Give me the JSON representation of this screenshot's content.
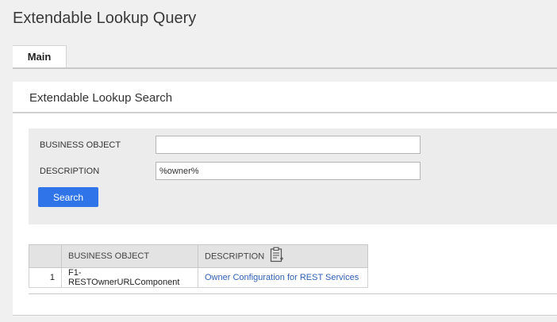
{
  "page": {
    "title": "Extendable Lookup Query"
  },
  "tabs": [
    {
      "label": "Main"
    }
  ],
  "panel": {
    "title": "Extendable Lookup Search"
  },
  "search": {
    "business_object_label": "BUSINESS OBJECT",
    "business_object_value": "",
    "description_label": "DESCRIPTION",
    "description_value": "%owner%",
    "button_label": "Search"
  },
  "results": {
    "columns": [
      "BUSINESS OBJECT",
      "DESCRIPTION"
    ],
    "rows": [
      {
        "index": "1",
        "business_object": "F1-RESTOwnerURLComponent",
        "description": "Owner Configuration for REST Services"
      }
    ]
  },
  "icons": {
    "description_header_icon": "clipboard-icon"
  },
  "colors": {
    "button": "#2f74e8",
    "link": "#2f5fb8"
  }
}
